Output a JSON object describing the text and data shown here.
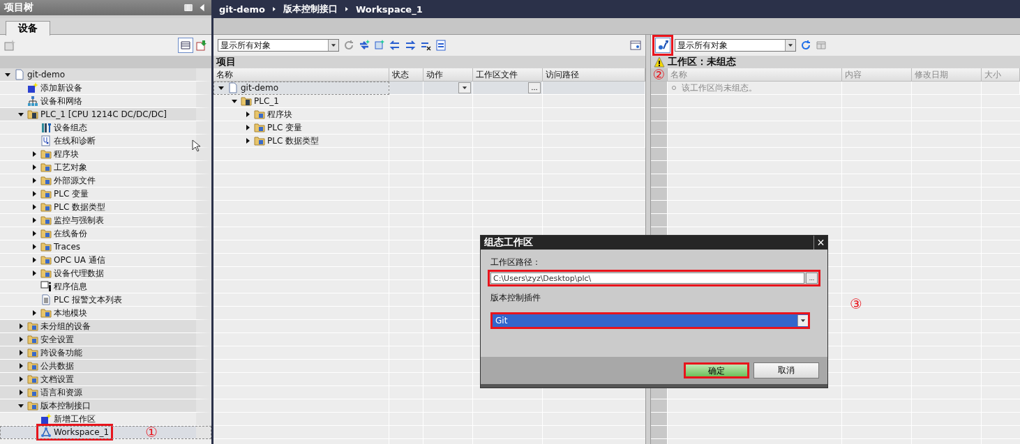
{
  "project_tree": {
    "title": "项目树",
    "tabs": [
      {
        "label": "设备",
        "selected": true
      }
    ],
    "items": [
      {
        "label": "git-demo",
        "kind": "project",
        "expanded": true,
        "selected": false,
        "annotated": false,
        "children": [
          {
            "label": "添加新设备",
            "kind": "add",
            "selected": false,
            "annotated": false
          },
          {
            "label": "设备和网络",
            "kind": "network",
            "selected": false,
            "annotated": false
          },
          {
            "label": "PLC_1 [CPU 1214C DC/DC/DC]",
            "kind": "plc",
            "expanded": true,
            "selected": false,
            "annotated": false,
            "children": [
              {
                "label": "设备组态",
                "kind": "config",
                "selected": false,
                "annotated": false
              },
              {
                "label": "在线和诊断",
                "kind": "diag",
                "selected": false,
                "annotated": false
              },
              {
                "label": "程序块",
                "kind": "folder",
                "expanded": false,
                "selected": false,
                "annotated": false
              },
              {
                "label": "工艺对象",
                "kind": "folder",
                "expanded": false,
                "selected": false,
                "annotated": false
              },
              {
                "label": "外部源文件",
                "kind": "folder",
                "expanded": false,
                "selected": false,
                "annotated": false
              },
              {
                "label": "PLC 变量",
                "kind": "folder",
                "expanded": false,
                "selected": false,
                "annotated": false
              },
              {
                "label": "PLC 数据类型",
                "kind": "folder",
                "expanded": false,
                "selected": false,
                "annotated": false
              },
              {
                "label": "监控与强制表",
                "kind": "folder",
                "expanded": false,
                "selected": false,
                "annotated": false
              },
              {
                "label": "在线备份",
                "kind": "folder",
                "expanded": false,
                "selected": false,
                "annotated": false
              },
              {
                "label": "Traces",
                "kind": "folder",
                "expanded": false,
                "selected": false,
                "annotated": false
              },
              {
                "label": "OPC UA 通信",
                "kind": "folder",
                "expanded": false,
                "selected": false,
                "annotated": false
              },
              {
                "label": "设备代理数据",
                "kind": "folder",
                "expanded": false,
                "selected": false,
                "annotated": false
              },
              {
                "label": "程序信息",
                "kind": "info",
                "selected": false,
                "annotated": false
              },
              {
                "label": "PLC 报警文本列表",
                "kind": "doc",
                "selected": false,
                "annotated": false
              },
              {
                "label": "本地模块",
                "kind": "folder",
                "expanded": false,
                "selected": false,
                "annotated": false
              }
            ]
          },
          {
            "label": "未分组的设备",
            "kind": "folder",
            "expanded": false,
            "selected": false,
            "annotated": false
          },
          {
            "label": "安全设置",
            "kind": "folder",
            "expanded": false,
            "selected": false,
            "annotated": false
          },
          {
            "label": "跨设备功能",
            "kind": "folder",
            "expanded": false,
            "selected": false,
            "annotated": false
          },
          {
            "label": "公共数据",
            "kind": "folder",
            "expanded": false,
            "selected": false,
            "annotated": false
          },
          {
            "label": "文档设置",
            "kind": "folder",
            "expanded": false,
            "selected": false,
            "annotated": false
          },
          {
            "label": "语言和资源",
            "kind": "folder",
            "expanded": false,
            "selected": false,
            "annotated": false
          },
          {
            "label": "版本控制接口",
            "kind": "folder",
            "expanded": true,
            "selected": false,
            "annotated": false,
            "children": [
              {
                "label": "新增工作区",
                "kind": "add",
                "selected": false,
                "annotated": false
              },
              {
                "label": "Workspace_1",
                "kind": "workspace",
                "selected": true,
                "annotated": true,
                "note": "①"
              }
            ]
          }
        ]
      }
    ]
  },
  "breadcrumb": [
    "git-demo",
    "版本控制接口",
    "Workspace_1"
  ],
  "project_pane": {
    "filter": "显示所有对象",
    "title": "项目",
    "columns": [
      "名称",
      "状态",
      "动作",
      "工作区文件",
      "访问路径"
    ],
    "rows": [
      {
        "label": "git-demo",
        "kind": "project",
        "expanded": true,
        "selected": true,
        "children": [
          {
            "label": "PLC_1",
            "kind": "plc",
            "expanded": true,
            "selected": false,
            "children": [
              {
                "label": "程序块",
                "kind": "folder",
                "expanded": false,
                "selected": false
              },
              {
                "label": "PLC 变量",
                "kind": "folder",
                "expanded": false,
                "selected": false
              },
              {
                "label": "PLC 数据类型",
                "kind": "folder",
                "expanded": false,
                "selected": false
              }
            ]
          }
        ]
      }
    ]
  },
  "workspace_pane": {
    "configure_button": {
      "annotated": true,
      "note": "②"
    },
    "filter": "显示所有对象",
    "title": "工作区：未组态",
    "columns": [
      "名称",
      "内容",
      "修改日期",
      "大小"
    ],
    "rows": [
      "该工作区尚未组态。"
    ]
  },
  "dialog": {
    "title": "组态工作区",
    "close": "×",
    "note": "③",
    "path": {
      "label": "工作区路径：",
      "value": "C:\\Users\\zyz\\Desktop\\plc\\",
      "browse": "...",
      "annotated": true
    },
    "plugin": {
      "label": "版本控制插件",
      "value": "Git",
      "annotated": true
    },
    "buttons": [
      {
        "label": "确定",
        "kind": "primary",
        "annotated": true
      },
      {
        "label": "取消",
        "kind": "secondary",
        "annotated": false
      }
    ]
  }
}
